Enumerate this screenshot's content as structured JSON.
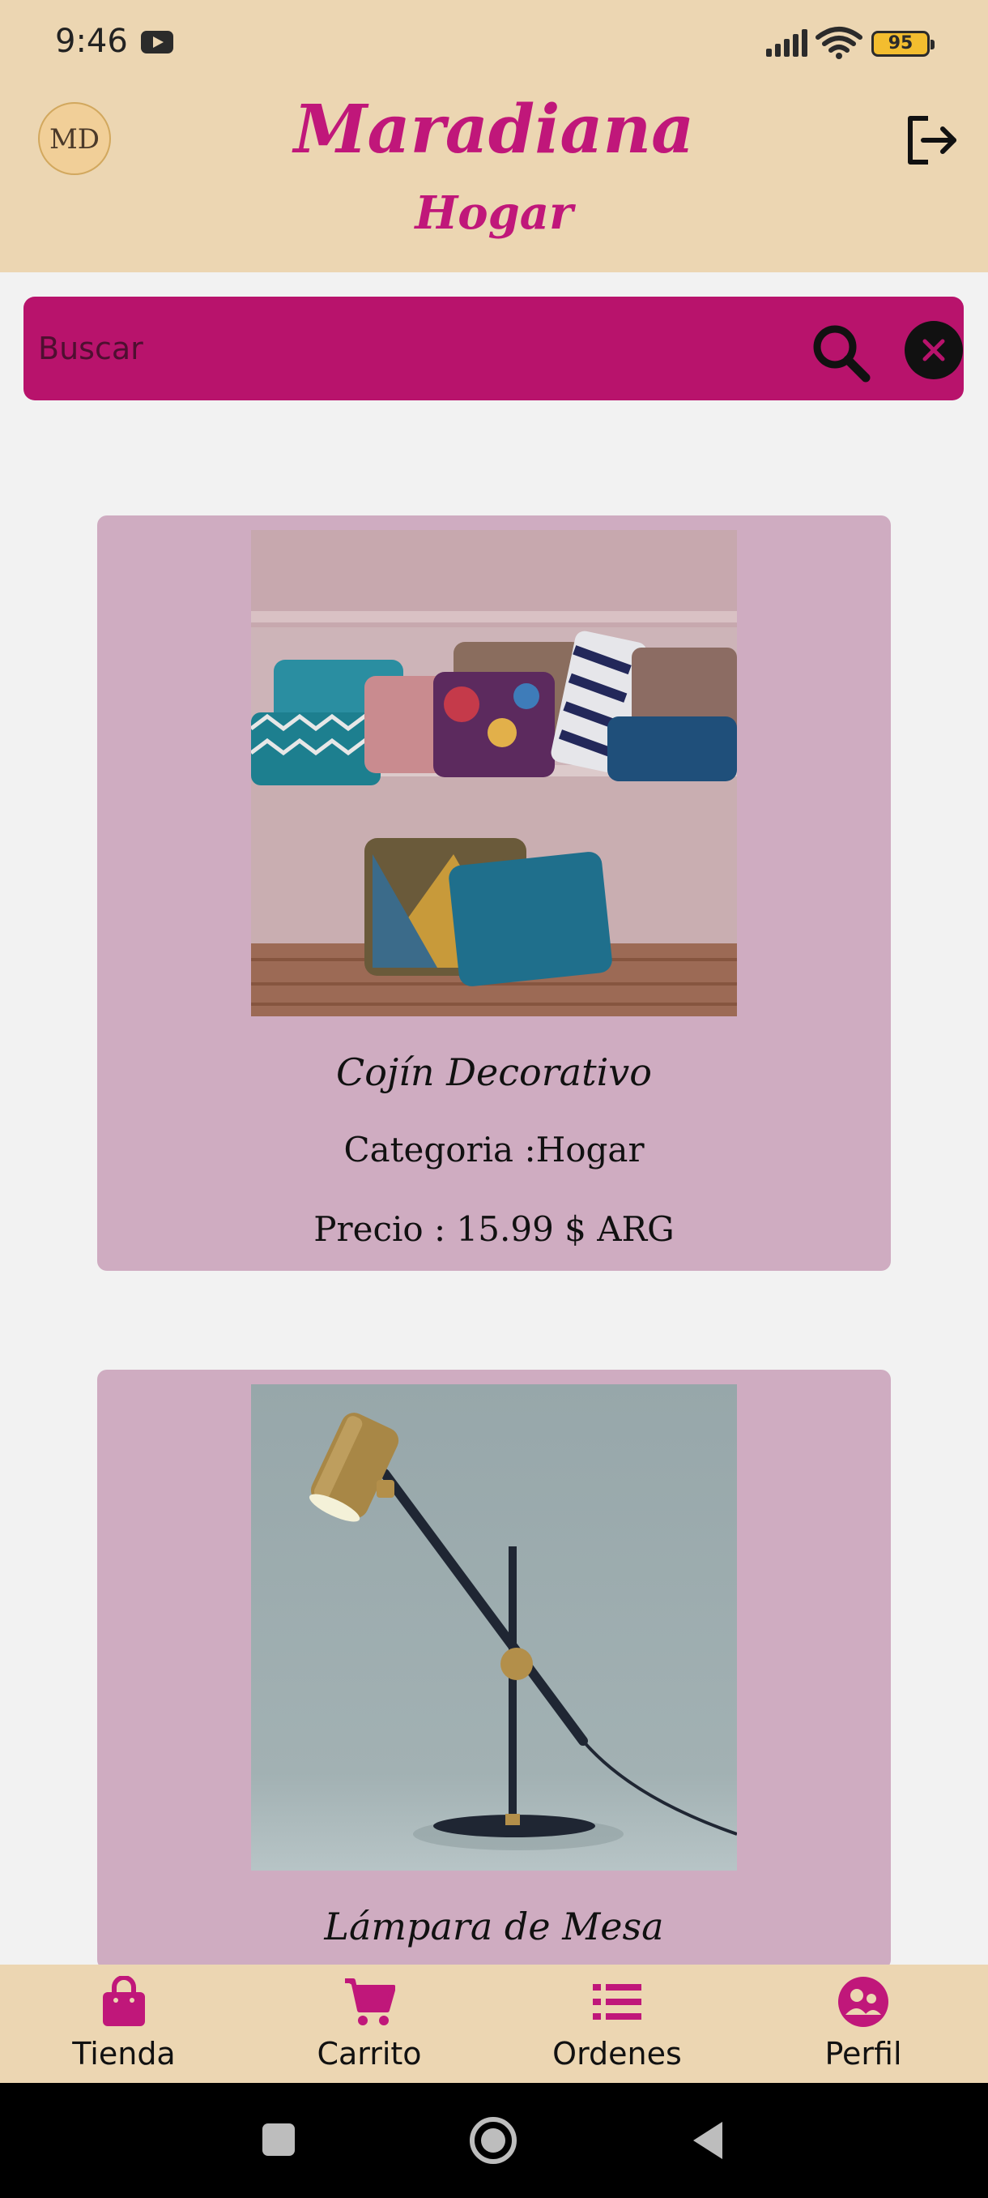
{
  "status_bar": {
    "time": "9:46",
    "battery": "95"
  },
  "header": {
    "logo_text": "MD",
    "title": "Maradiana",
    "subtitle": "Hogar"
  },
  "search": {
    "placeholder": "Buscar"
  },
  "products": [
    {
      "name": "Cojín Decorativo",
      "category": "Categoria :Hogar",
      "price": "Precio : 15.99 $ ARG",
      "image_icon": "cushions-image"
    },
    {
      "name": "Lámpara de Mesa",
      "image_icon": "desk-lamp-image"
    }
  ],
  "bottom_nav": {
    "items": [
      {
        "label": "Tienda",
        "icon": "shopping-bag-icon"
      },
      {
        "label": "Carrito",
        "icon": "cart-icon"
      },
      {
        "label": "Ordenes",
        "icon": "list-icon"
      },
      {
        "label": "Perfil",
        "icon": "profile-icon"
      }
    ]
  },
  "colors": {
    "header_bg": "#ecd6b2",
    "accent": "#c0177a",
    "search_bg": "#b8136c",
    "card_bg": "#cfacc1",
    "page_bg": "#f2f2f2"
  }
}
